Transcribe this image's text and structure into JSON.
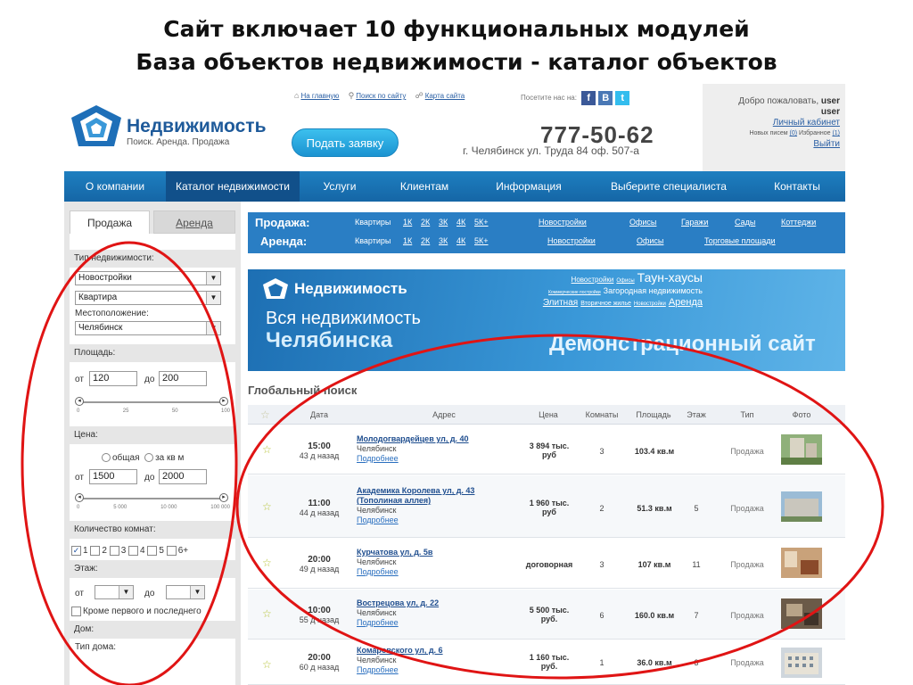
{
  "slide": {
    "title_line1": "Сайт включает 10 функциональных модулей",
    "title_line2": "База объектов недвижимости - каталог объектов"
  },
  "header": {
    "brand": "Недвижимость",
    "tagline": "Поиск. Аренда. Продажа",
    "links": [
      "На главную",
      "Поиск по сайту",
      "Карта сайта"
    ],
    "visit_label": "Посетите нас на:",
    "social": [
      "f",
      "B",
      "t"
    ],
    "submit_label": "Подать заявку",
    "phone": "777-50-62",
    "address": "г. Челябинск ул. Труда 84 оф. 507-а"
  },
  "user": {
    "welcome_prefix": "Добро пожаловать,",
    "welcome_user": "user",
    "name": "user",
    "cabinet": "Личный кабинет",
    "letters_prefix": "Новых писем",
    "letters_count": "(0)",
    "favorites_prefix": "Избранное",
    "favorites_count": "(1)",
    "logout": "Выйти"
  },
  "menu": [
    "О компании",
    "Каталог недвижимости",
    "Услуги",
    "Клиентам",
    "Информация",
    "Выберите специалиста",
    "Контакты"
  ],
  "sidebar": {
    "tab_sale": "Продажа",
    "tab_rent": "Аренда",
    "type_label": "Тип недвижимости:",
    "type_value1": "Новостройки",
    "type_value2": "Квартира",
    "location_label": "Местоположение:",
    "location_value": "Челябинск",
    "area_label": "Площадь:",
    "from": "от",
    "to": "до",
    "area_from": "120",
    "area_to": "200",
    "area_ticks": [
      "0",
      "25",
      "50",
      "100"
    ],
    "price_label": "Цена:",
    "price_total": "общая",
    "price_sqm": "за кв м",
    "price_from": "1500",
    "price_to": "2000",
    "price_ticks": [
      "0",
      "5 000",
      "10 000",
      "100 000"
    ],
    "rooms_label": "Количество комнат:",
    "rooms": [
      "1",
      "2",
      "3",
      "4",
      "5",
      "6+"
    ],
    "floor_label": "Этаж:",
    "except_label": "Кроме первого и последнего",
    "house_label": "Дом:",
    "house_type_label": "Тип дома:"
  },
  "quick": {
    "sale_label": "Продажа:",
    "rent_label": "Аренда:",
    "sale_links": [
      "Квартиры",
      "1К",
      "2К",
      "3К",
      "4К",
      "5К+",
      "Новостройки",
      "Офисы",
      "Гаражи",
      "Сады",
      "Коттеджи"
    ],
    "rent_links": [
      "Квартиры",
      "1К",
      "2К",
      "3К",
      "4К",
      "5К+",
      "Новостройки",
      "Офисы",
      "Торговые площади"
    ]
  },
  "banner": {
    "brand": "Недвижимость",
    "line1": "Вся недвижимость",
    "line2": "Челябинска",
    "demo": "Демонстрационный сайт",
    "tags_line1": [
      "Новостройки",
      "Офисы",
      "Таун-хаусы"
    ],
    "tags_line2": [
      "Коммерческие постройки",
      "Загородная недвижимость"
    ],
    "tags_line3": [
      "Элитная",
      "Вторичное жилье",
      "Новостройки",
      "Аренда"
    ]
  },
  "search": {
    "title": "Глобальный поиск",
    "columns": [
      "Дата",
      "Адрес",
      "Цена",
      "Комнаты",
      "Площадь",
      "Этаж",
      "Тип",
      "Фото"
    ],
    "rows": [
      {
        "time": "15:00",
        "ago": "43 д назад",
        "street": "Молодогвардейцев ул, д. 40",
        "street2": "",
        "city": "Челябинск",
        "more": "Подробнее",
        "price1": "3 894 тыс.",
        "price2": "руб",
        "rooms": "3",
        "area": "103.4 кв.м",
        "floor": "",
        "type": "Продажа"
      },
      {
        "time": "11:00",
        "ago": "44 д назад",
        "street": "Академика Королева ул, д. 43",
        "street2": "(Тополиная аллея)",
        "city": "Челябинск",
        "more": "Подробнее",
        "price1": "1 960 тыс.",
        "price2": "руб",
        "rooms": "2",
        "area": "51.3 кв.м",
        "floor": "5",
        "type": "Продажа"
      },
      {
        "time": "20:00",
        "ago": "49 д назад",
        "street": "Курчатова ул, д. 5в",
        "street2": "",
        "city": "Челябинск",
        "more": "Подробнее",
        "price1": "договорная",
        "price2": "",
        "rooms": "3",
        "area": "107 кв.м",
        "floor": "11",
        "type": "Продажа"
      },
      {
        "time": "10:00",
        "ago": "55 д назад",
        "street": "Вострецова ул, д. 22",
        "street2": "",
        "city": "Челябинск",
        "more": "Подробнее",
        "price1": "5 500 тыс.",
        "price2": "руб.",
        "rooms": "6",
        "area": "160.0 кв.м",
        "floor": "7",
        "type": "Продажа"
      },
      {
        "time": "20:00",
        "ago": "60 д назад",
        "street": "Комаровского ул, д. 6",
        "street2": "",
        "city": "Челябинск",
        "more": "Подробнее",
        "price1": "1 160 тыс.",
        "price2": "руб.",
        "rooms": "1",
        "area": "36.0 кв.м",
        "floor": "3",
        "type": "Продажа"
      }
    ]
  }
}
